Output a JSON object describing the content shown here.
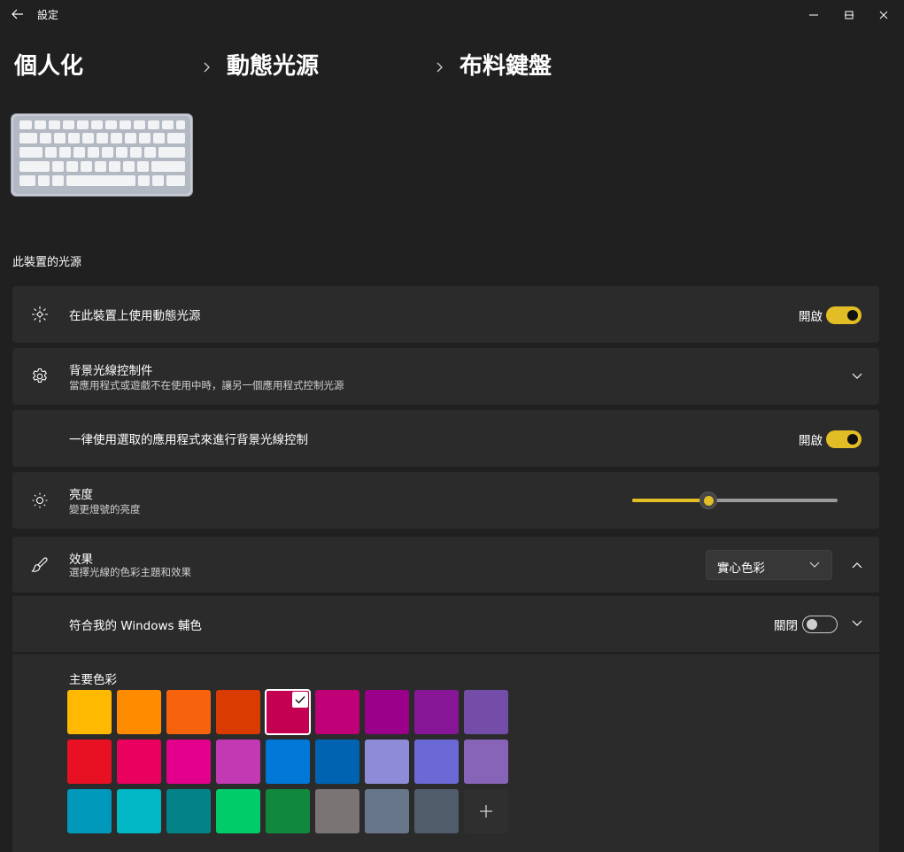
{
  "window": {
    "app_title": "設定",
    "icons": {
      "back": "back-arrow-icon",
      "minimize": "minimize-icon",
      "maximize": "maximize-icon",
      "close": "close-icon"
    }
  },
  "breadcrumb": {
    "items": [
      "個人化",
      "動態光源",
      "布料鍵盤"
    ]
  },
  "device": {
    "image": "keyboard-illustration"
  },
  "section": {
    "title": "此裝置的光源"
  },
  "settings": {
    "use_dynamic_lighting": {
      "title": "在此裝置上使用動態光源",
      "toggle_label": "開啟",
      "state": "on",
      "icon": "dynamic-lighting-icon"
    },
    "background_control": {
      "title": "背景光線控制件",
      "subtitle": "當應用程式或遊戲不在使用中時，讓另一個應用程式控制光源",
      "icon": "gear-icon"
    },
    "always_use_selected_app": {
      "title": "一律使用選取的應用程式來進行背景光線控制",
      "toggle_label": "開啟",
      "state": "on"
    },
    "brightness": {
      "title": "亮度",
      "subtitle": "變更燈號的亮度",
      "icon": "brightness-sun-icon",
      "value_fraction": 0.37
    },
    "effects": {
      "title": "效果",
      "subtitle": "選擇光線的色彩主題和效果",
      "icon": "brush-icon",
      "dropdown_value": "實心色彩"
    },
    "match_accent": {
      "title": "符合我的 Windows 輔色",
      "toggle_label": "關閉",
      "state": "off"
    },
    "main_color": {
      "title": "主要色彩",
      "selected_index": 4,
      "swatches": [
        [
          "#ffb900",
          "#ff8c00",
          "#f7630c",
          "#da3b01",
          "#c30052",
          "#bf0077",
          "#9a0089",
          "#881798",
          "#744da9"
        ],
        [
          "#e81123",
          "#ea005e",
          "#e3008c",
          "#c239b3",
          "#0078d7",
          "#0063b1",
          "#8e8cd8",
          "#6b69d6",
          "#8764b8"
        ],
        [
          "#0099bc",
          "#00b7c3",
          "#038387",
          "#00cc6a",
          "#10893e",
          "#7a7574",
          "#68768a",
          "#515c6b"
        ]
      ],
      "add_icon": "plus-icon"
    }
  },
  "colors": {
    "accent": "#e3bd25",
    "background": "#202020",
    "card": "#2b2b2b"
  }
}
